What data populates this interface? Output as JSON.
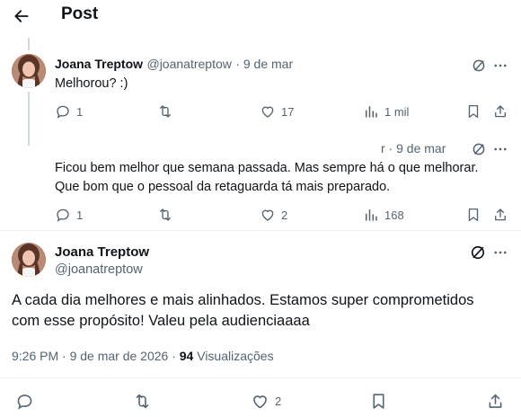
{
  "header": {
    "title": "Post"
  },
  "reply1": {
    "name": "Joana Treptow",
    "handle": "@joanatreptow",
    "date": "· 9 de mar",
    "text": "Melhorou? :)",
    "replies": "1",
    "likes": "17",
    "views": "1 mil"
  },
  "reply2": {
    "meta": "r · 9 de mar",
    "text_line1": "Ficou bem melhor que semana passada. Mas sempre há o que melhorar.",
    "text_line2": "Que bom que o pessoal da retaguarda tá mais preparado.",
    "replies": "1",
    "likes": "2",
    "views": "168"
  },
  "main": {
    "name": "Joana Treptow",
    "handle": "@joanatreptow",
    "text_line1": "A cada dia melhores e mais alinhados. Estamos super comprometidos",
    "text_line2": "com esse propósito! Valeu pela audienciaaaa",
    "time": "9:26 PM · 9 de mar de 2026 · ",
    "views_count": "94",
    "views_label": "Visualizações",
    "likes": "2"
  },
  "icons": {
    "back": "arrow-left-icon",
    "grok": "grok-icon",
    "more": "more-icon",
    "reply": "reply-icon",
    "repost": "repost-icon",
    "like": "heart-icon",
    "views": "views-icon",
    "bookmark": "bookmark-icon",
    "share": "share-icon"
  }
}
